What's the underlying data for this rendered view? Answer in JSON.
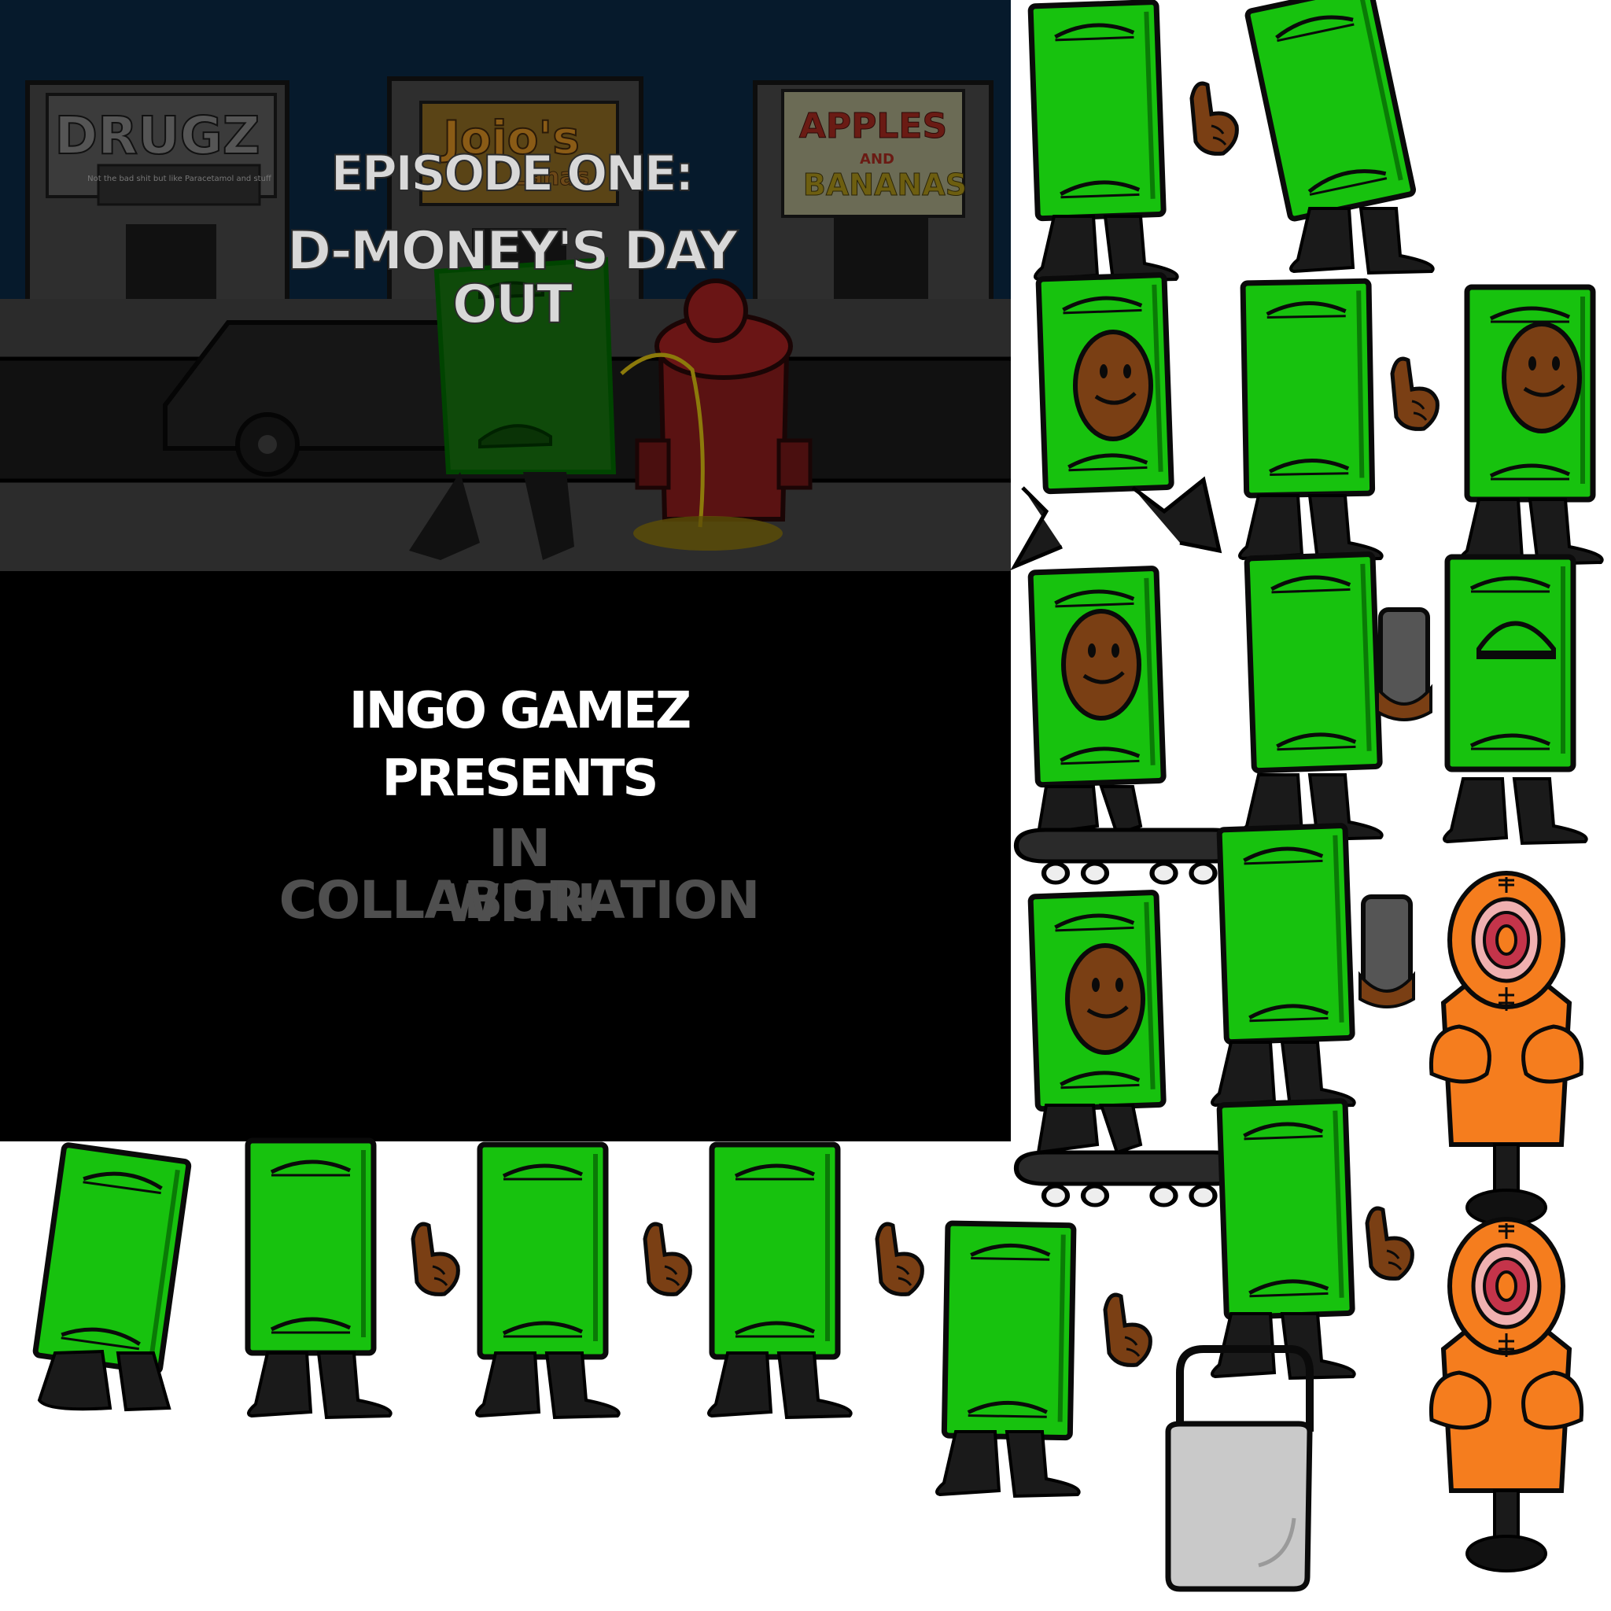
{
  "scene": {
    "sign_drugz": "DRUGZ",
    "sign_drugz_sub": "Not the bad shit but like Paracetamol and stuff",
    "sign_jojos": "Jojo's",
    "sign_jojos_sub": "Lanas",
    "sign_apples_1": "APPLES",
    "sign_apples_2": "AND",
    "sign_apples_3": "BANANAS",
    "title_line1": "EPISODE ONE:",
    "title_line2": "D-MONEY'S DAY OUT"
  },
  "title_card": {
    "line1": "INGO GAMEZ",
    "line2": "PRESENTS",
    "line3": "IN COLLABORATION",
    "line4": "WITH"
  },
  "colors": {
    "sky": "#061a2c",
    "sidewalk": "#3a3a3a",
    "card_bg": "#000000",
    "money_green": "#17c20e",
    "money_outline": "#0a0a0a",
    "skin": "#7a3f14",
    "legs": "#1a1a1a",
    "orange": "#f57d1e",
    "bag": "#c9c9c9"
  },
  "sprites": [
    "dmoney-front-tilt",
    "hand-icon",
    "dmoney-lean",
    "dmoney-walk-face",
    "dmoney-idle",
    "hand-icon",
    "dmoney-face",
    "dmoney-skate-face",
    "dmoney-idle-phone",
    "phone-icon",
    "dmoney-back",
    "dmoney-phone-hold",
    "target-dummy",
    "dmoney-skate-face",
    "hand-icon",
    "target-dummy",
    "shopping-bag-icon"
  ]
}
